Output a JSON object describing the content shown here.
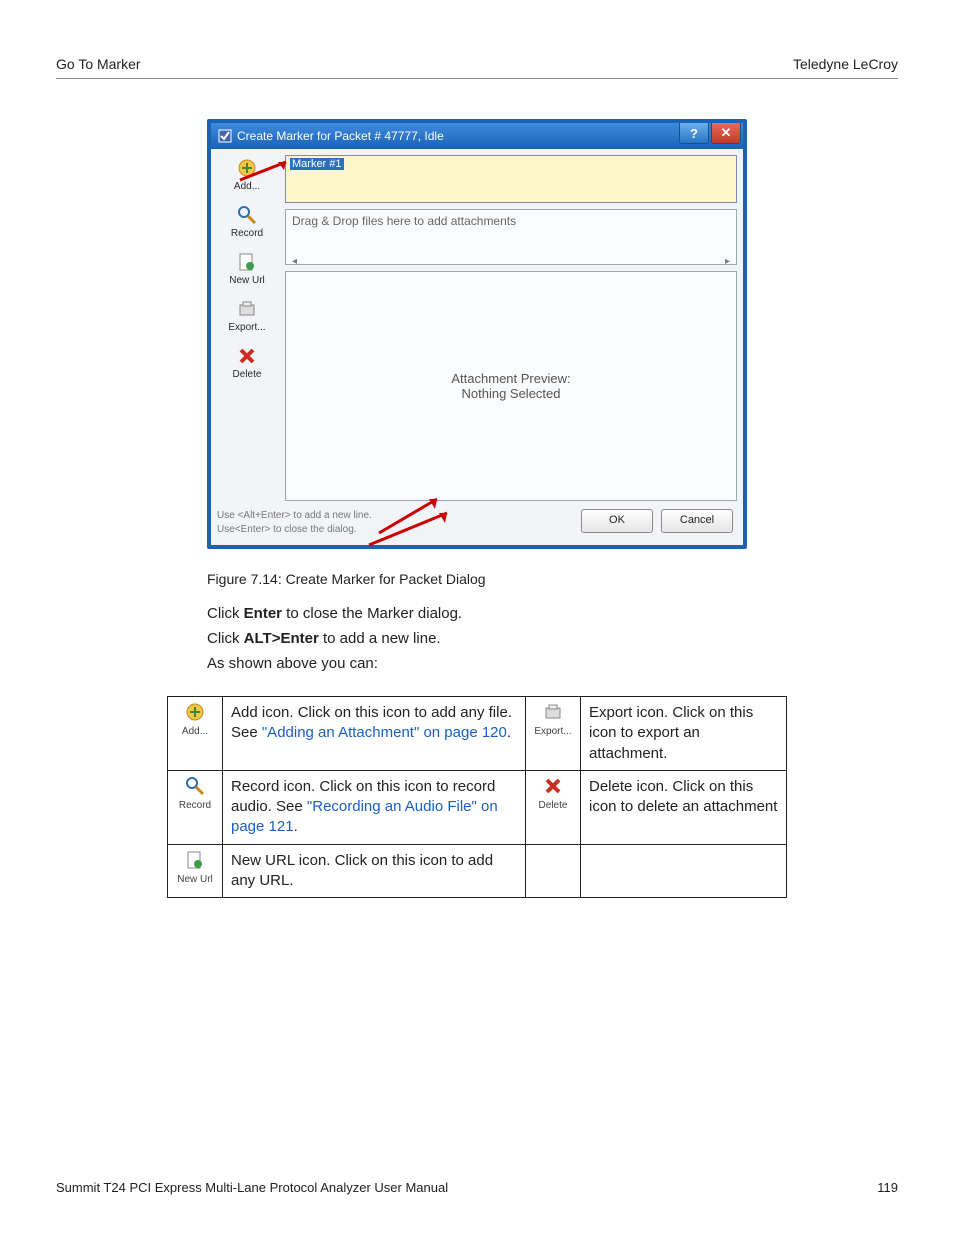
{
  "header": {
    "left": "Go To Marker",
    "right": "Teledyne LeCroy"
  },
  "dialog": {
    "title": "Create Marker for Packet # 47777, Idle",
    "marker_name": "Marker #1",
    "dropzone_text": "Drag & Drop files here to add attachments",
    "preview_title": "Attachment Preview:",
    "preview_sub": "Nothing Selected",
    "hint1": "Use <Alt+Enter> to add a new line.",
    "hint2": "Use<Enter> to close the dialog.",
    "ok_label": "OK",
    "cancel_label": "Cancel",
    "side": {
      "add": "Add...",
      "record": "Record",
      "newurl": "New Url",
      "export": "Export...",
      "delete": "Delete"
    }
  },
  "caption": "Figure 7.14:  Create Marker for Packet Dialog",
  "body": {
    "p1a": "Click ",
    "p1b": "Enter",
    "p1c": " to close the Marker dialog.",
    "p2a": "Click ",
    "p2b": "ALT>Enter",
    "p2c": " to add a new line.",
    "p3": "As shown above you can:"
  },
  "table": {
    "add_label": "Add...",
    "add_text_a": "Add icon. Click on this icon to add any file. See ",
    "add_link": "\"Adding an Attachment\" on page 120",
    "add_text_b": ".",
    "export_label": "Export...",
    "export_text": "Export icon. Click on this icon to export an attachment.",
    "record_label": "Record",
    "record_text_a": "Record icon. Click on this icon to record audio. See ",
    "record_link": "\"Recording an Audio File\" on page 121",
    "record_text_b": ".",
    "delete_label": "Delete",
    "delete_text": "Delete icon. Click on this icon to delete an attachment",
    "newurl_label": "New Url",
    "newurl_text": "New URL icon. Click on this icon to add any URL."
  },
  "footer": {
    "left": "Summit T24 PCI Express Multi-Lane Protocol Analyzer User Manual",
    "right": "119"
  }
}
